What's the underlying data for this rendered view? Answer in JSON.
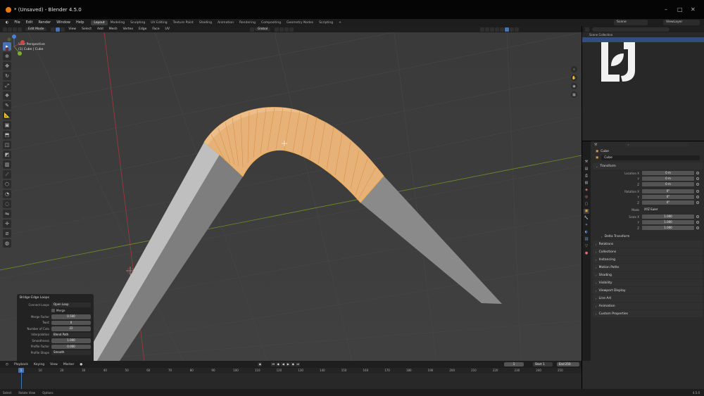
{
  "window": {
    "title": "* (Unsaved) - Blender 4.5.0"
  },
  "menu": [
    "File",
    "Edit",
    "Render",
    "Window",
    "Help"
  ],
  "workspaces": [
    "Layout",
    "Modeling",
    "Sculpting",
    "UV Editing",
    "Texture Paint",
    "Shading",
    "Animation",
    "Rendering",
    "Compositing",
    "Geometry Nodes",
    "Scripting"
  ],
  "scene": {
    "name": "Scene",
    "view_layer": "ViewLayer"
  },
  "viewport_header": {
    "mode": "Edit Mode",
    "menus": [
      "View",
      "Select",
      "Add",
      "Mesh",
      "Vertex",
      "Edge",
      "Face",
      "UV"
    ],
    "transform_orientation": "Global",
    "options": "Options"
  },
  "viewport": {
    "perspective": "User Perspective",
    "object": "(1) Cube | Cube"
  },
  "tool_icons": [
    "select-box-icon",
    "cursor-icon",
    "move-icon",
    "rotate-icon",
    "scale-icon",
    "transform-icon",
    "annotate-icon",
    "measure-icon",
    "add-cube-icon",
    "extrude-icon",
    "inset-icon",
    "bevel-icon",
    "loop-cut-icon",
    "knife-icon",
    "poly-build-icon",
    "spin-icon",
    "smooth-icon",
    "edge-slide-icon",
    "shrink-fatten-icon",
    "shear-icon",
    "rip-icon"
  ],
  "redo_panel": {
    "title": "Bridge Edge Loops",
    "connect_loops_label": "Connect Loops",
    "connect_loops": "Open Loop",
    "merge_label": "Merge",
    "merge_factor_label": "Merge Factor",
    "merge_factor": "0.500",
    "twist_label": "Twist",
    "twist": "0",
    "cuts_label": "Number of Cuts",
    "cuts": "22",
    "interpolation_label": "Interpolation",
    "interpolation": "Blend Path",
    "smoothness_label": "Smoothness",
    "smoothness": "1.000",
    "profile_factor_label": "Profile Factor",
    "profile_factor": "0.000",
    "profile_shape_label": "Profile Shape",
    "profile_shape": "Smooth"
  },
  "outliner": {
    "collection": "Scene Collection"
  },
  "properties": {
    "object_tab_name": "Cube",
    "object_name": "Cube",
    "transform": "Transform",
    "location_x_label": "Location X",
    "location_x": "0 m",
    "location_y_label": "Y",
    "location_y": "0 m",
    "location_z_label": "Z",
    "location_z": "0 m",
    "rotation_x_label": "Rotation X",
    "rotation_x": "0°",
    "rotation_y_label": "Y",
    "rotation_y": "0°",
    "rotation_z_label": "Z",
    "rotation_z": "0°",
    "mode_label": "Mode",
    "mode": "XYZ Euler",
    "scale_x_label": "Scale X",
    "scale_x": "1.000",
    "scale_y_label": "Y",
    "scale_y": "1.000",
    "scale_z_label": "Z",
    "scale_z": "1.000",
    "delta_transform": "Delta Transform",
    "panels": [
      "Relations",
      "Collections",
      "Instancing",
      "Motion Paths",
      "Shading",
      "Visibility",
      "Viewport Display",
      "Line Art",
      "Animation",
      "Custom Properties"
    ]
  },
  "timeline": {
    "menus": [
      "Playback",
      "Keying",
      "View",
      "Marker"
    ],
    "current_frame": "1",
    "start_label": "Start",
    "start": "1",
    "end_label": "End",
    "end": "250",
    "ticks": [
      "1",
      "10",
      "20",
      "30",
      "40",
      "50",
      "60",
      "70",
      "80",
      "90",
      "100",
      "110",
      "120",
      "130",
      "140",
      "150",
      "160",
      "170",
      "180",
      "190",
      "200",
      "210",
      "220",
      "230",
      "240",
      "250"
    ]
  },
  "status_bar": {
    "select": "Select",
    "rotate": "Rotate View",
    "options": "Options",
    "version": "4.5.0"
  },
  "colors": {
    "accent": "#4772b3",
    "selection": "#e8a55a",
    "viewport_bg": "#3c3c3c",
    "x_axis": "#a23a3a",
    "y_axis": "#6f8f2a"
  }
}
